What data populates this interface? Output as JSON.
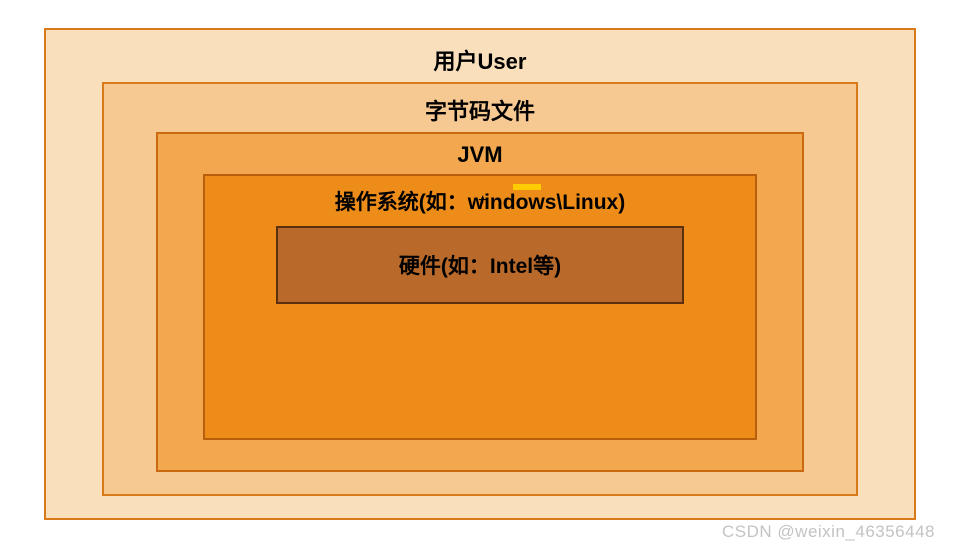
{
  "layers": {
    "l1": "用户User",
    "l2": "字节码文件",
    "l3": "JVM",
    "l4": "操作系统(如：windows\\Linux)",
    "l5": "硬件(如：Intel等)"
  },
  "plus_mark": "+",
  "watermark": "CSDN @weixin_46356448"
}
